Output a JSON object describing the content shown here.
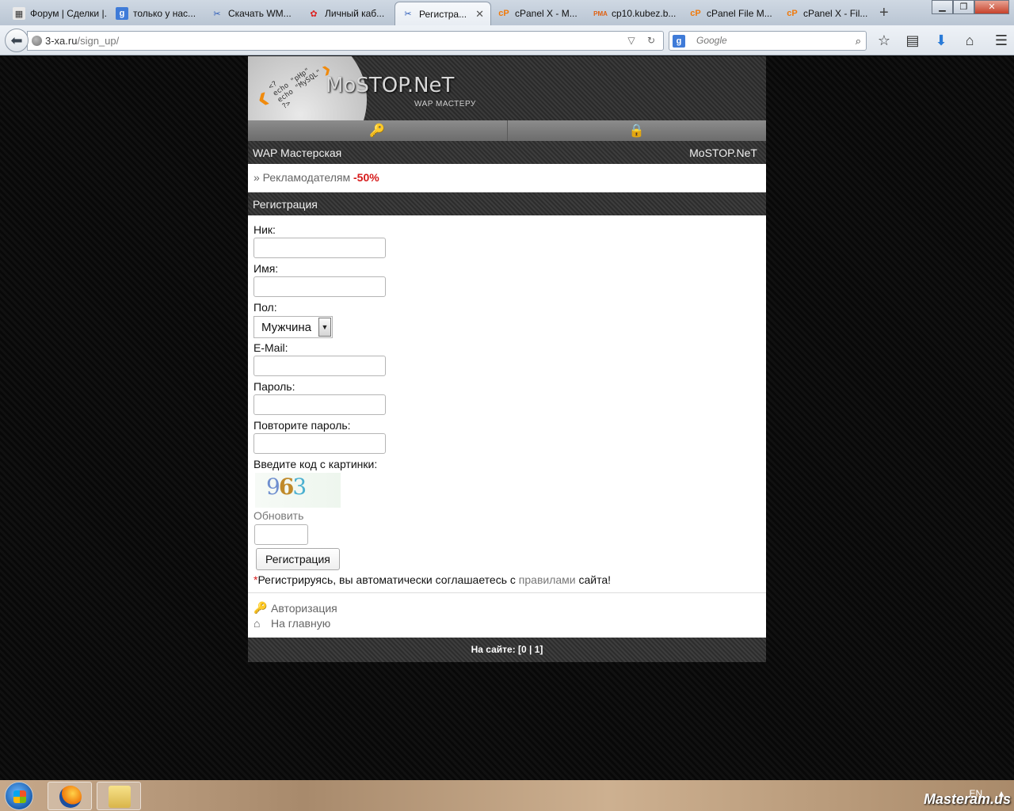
{
  "browser": {
    "tabs": [
      {
        "title": "Форум | Сделки |...",
        "icon": "forum-icon",
        "active": false
      },
      {
        "title": "только у нас...",
        "icon": "google-icon",
        "active": false
      },
      {
        "title": "Скачать WM...",
        "icon": "tools-icon",
        "active": false
      },
      {
        "title": "Личный каб...",
        "icon": "color-icon",
        "active": false
      },
      {
        "title": "Регистра...",
        "icon": "tools-icon",
        "active": true
      },
      {
        "title": "cPanel X - M...",
        "icon": "cpanel-icon",
        "active": false
      },
      {
        "title": "cp10.kubez.b...",
        "icon": "phpmyadmin-icon",
        "active": false
      },
      {
        "title": "cPanel File M...",
        "icon": "cpanel-icon",
        "active": false
      },
      {
        "title": "cPanel X - Fil...",
        "icon": "cpanel-icon",
        "active": false
      }
    ],
    "url_host": "3-xa.ru",
    "url_path": "/sign_up/",
    "search_placeholder": "Google"
  },
  "site": {
    "logo": "MoSTOP.NeT",
    "tagline": "WAP МАСТЕРУ",
    "nav_left": "WAP Мастерская",
    "nav_right": "MoSTOP.NeT",
    "ad_prefix": "» Рекламодателям",
    "ad_discount": "-50%",
    "section_title": "Регистрация"
  },
  "form": {
    "nick_label": "Ник:",
    "name_label": "Имя:",
    "gender_label": "Пол:",
    "gender_value": "Мужчина",
    "email_label": "E-Mail:",
    "password_label": "Пароль:",
    "password_repeat_label": "Повторите пароль:",
    "captcha_label": "Введите код с картинки:",
    "captcha_digit_1": "9",
    "captcha_digit_2": "6",
    "captcha_digit_3": "3",
    "refresh_label": "Обновить",
    "submit_label": "Регистрация",
    "agree_star": "*",
    "agree_text": "Регистрируясь, вы автоматически соглашаетесь с",
    "agree_link": "правилами",
    "agree_suffix": "сайта!"
  },
  "links": {
    "login": "Авторизация",
    "home": "На главную"
  },
  "footer": {
    "online": "На сайте: [0 | 1]"
  },
  "taskbar": {
    "lang": "EN",
    "watermark": "Masteram.us"
  }
}
